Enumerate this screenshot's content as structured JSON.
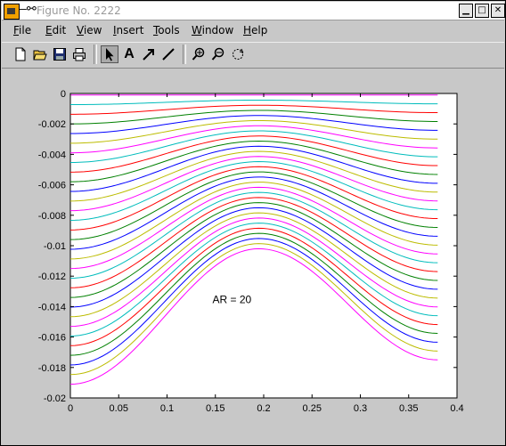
{
  "window": {
    "title": "Figure No. 2222",
    "title_glyph": "—⚯",
    "controls": [
      "▁",
      "□",
      "✕"
    ]
  },
  "menu": {
    "items": [
      {
        "label": "File",
        "underline": "F"
      },
      {
        "label": "Edit",
        "underline": "E"
      },
      {
        "label": "View",
        "underline": "V"
      },
      {
        "label": "Insert",
        "underline": "I"
      },
      {
        "label": "Tools",
        "underline": "T"
      },
      {
        "label": "Window",
        "underline": "W"
      },
      {
        "label": "Help",
        "underline": "H"
      }
    ]
  },
  "toolbar": {
    "tools": [
      "new-file-icon",
      "open-folder-icon",
      "save-icon",
      "print-icon",
      "select-arrow-icon",
      "insert-text-icon",
      "insert-arrow-icon",
      "insert-line-icon",
      "zoom-in-icon",
      "zoom-out-icon",
      "rotate-icon"
    ],
    "text_tool_label": "A"
  },
  "chart_data": {
    "type": "line",
    "title": "",
    "xlabel": "",
    "ylabel": "",
    "xlim": [
      0,
      0.4
    ],
    "ylim": [
      -0.02,
      0
    ],
    "xticks": [
      0,
      0.05,
      0.1,
      0.15,
      0.2,
      0.25,
      0.3,
      0.35,
      0.4
    ],
    "xtick_labels": [
      "0",
      "0.05",
      "0.1",
      "0.15",
      "0.2",
      "0.25",
      "0.3",
      "0.35",
      "0.4"
    ],
    "yticks": [
      0,
      -0.002,
      -0.004,
      -0.006,
      -0.008,
      -0.01,
      -0.012,
      -0.014,
      -0.016,
      -0.018,
      -0.02
    ],
    "ytick_labels": [
      "0",
      "-0.002",
      "-0.004",
      "-0.006",
      "-0.008",
      "-0.01",
      "-0.012",
      "-0.014",
      "-0.016",
      "-0.018",
      "-0.02"
    ],
    "annotation": "AR = 20",
    "grid": false,
    "curve_count": 31,
    "x_range": [
      0,
      0.38
    ],
    "peak_x": 0.195,
    "top_curve": {
      "y_left": -0.0001,
      "y_peak": -0.0001,
      "y_right": -0.0001
    },
    "bottom_curve": {
      "y_left": -0.0191,
      "y_peak": -0.0102,
      "y_right": -0.0175
    },
    "colors": [
      "#ff00ff",
      "#00bcbc",
      "#ff0000",
      "#008000",
      "#0000ff",
      "#bcbc00"
    ]
  }
}
